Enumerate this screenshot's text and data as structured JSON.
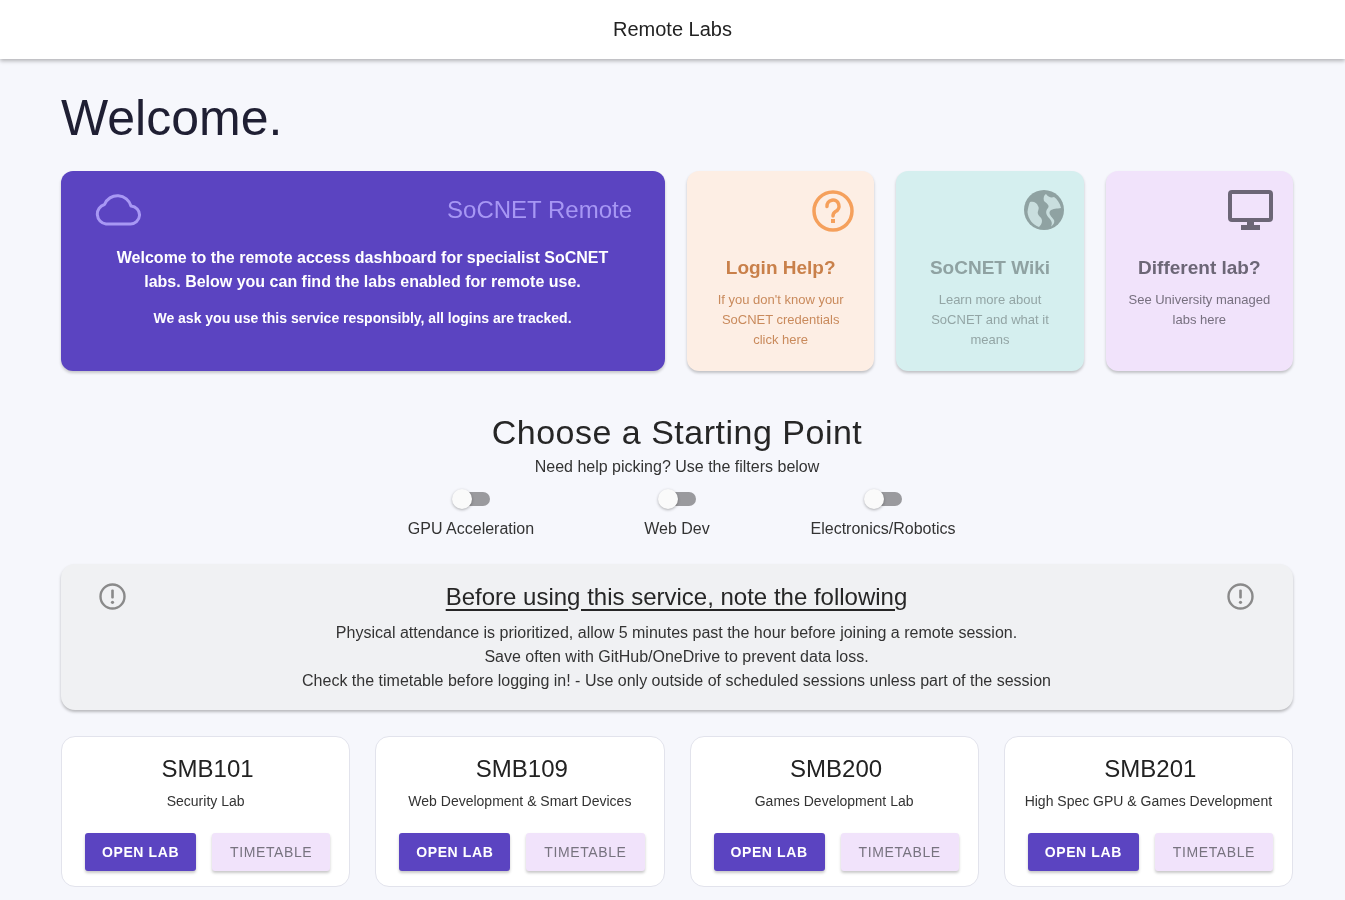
{
  "header": {
    "title": "Remote Labs"
  },
  "welcome_heading": "Welcome.",
  "intro_card": {
    "title": "SoCNET Remote",
    "message": "Welcome to the remote access dashboard for specialist SoCNET labs. Below you can find the labs enabled for remote use.",
    "note": "We ask you use this service responsibly, all logins are tracked."
  },
  "link_cards": [
    {
      "kind": "help",
      "color": "#fdeee4",
      "title": "Login Help?",
      "description": "If you don't know your SoCNET credentials click here"
    },
    {
      "kind": "wiki",
      "color": "#d5efef",
      "title": "SoCNET Wiki",
      "description": "Learn more about SoCNET and what it means"
    },
    {
      "kind": "labs",
      "color": "#f1e3fb",
      "title": "Different lab?",
      "description": "See University managed labs here"
    }
  ],
  "starting_point": {
    "title": "Choose a Starting Point",
    "subtitle": "Need help picking? Use the filters below",
    "filters": [
      {
        "label": "GPU Acceleration",
        "on": false
      },
      {
        "label": "Web Dev",
        "on": false
      },
      {
        "label": "Electronics/Robotics",
        "on": false
      }
    ]
  },
  "notice": {
    "title": "Before using this service, note the following",
    "lines": [
      "Physical attendance is prioritized, allow 5 minutes past the hour before joining a remote session.",
      "Save often with GitHub/OneDrive to prevent data loss.",
      "Check the timetable before logging in! - Use only outside of scheduled sessions unless part of the session"
    ]
  },
  "labs": [
    {
      "code": "SMB101",
      "name": "Security Lab",
      "actions": [
        {
          "label": "OPEN LAB",
          "kind": "primary"
        },
        {
          "label": "TIMETABLE",
          "kind": "secondary"
        }
      ]
    },
    {
      "code": "SMB109",
      "name": "Web Development & Smart Devices",
      "actions": [
        {
          "label": "OPEN LAB",
          "kind": "primary"
        },
        {
          "label": "TIMETABLE",
          "kind": "secondary"
        }
      ]
    },
    {
      "code": "SMB200",
      "name": "Games Development Lab",
      "actions": [
        {
          "label": "OPEN LAB",
          "kind": "primary"
        },
        {
          "label": "TIMETABLE",
          "kind": "secondary"
        }
      ]
    },
    {
      "code": "SMB201",
      "name": "High Spec GPU & Games Development",
      "actions": [
        {
          "label": "OPEN LAB",
          "kind": "primary"
        },
        {
          "label": "TIMETABLE",
          "kind": "secondary"
        }
      ]
    }
  ]
}
